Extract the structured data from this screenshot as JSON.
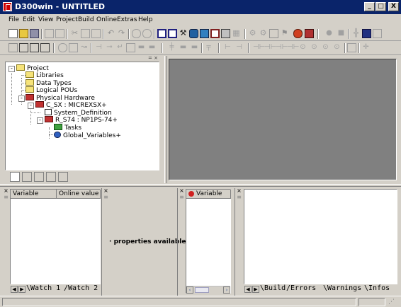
{
  "window": {
    "title": "D300win - UNTITLED",
    "minimize": "_",
    "maximize": "□",
    "close": "X"
  },
  "menu": [
    "File",
    "Edit",
    "View",
    "Project",
    "Build",
    "Online",
    "Extras",
    "Help"
  ],
  "project_tree": {
    "root": "Project",
    "items": [
      "Libraries",
      "Data Types",
      "Logical POUs",
      "Physical Hardware",
      "C_SX : MICREXSX+",
      "System_Definition",
      "R_S74 : NP1PS-74+",
      "Tasks",
      "Global_Variables+"
    ]
  },
  "watch_panel": {
    "col_variable": "Variable",
    "col_online_value": "Online value",
    "tabs": [
      "Watch 1",
      "Watch 2"
    ]
  },
  "properties_panel": {
    "message": "properties available"
  },
  "variable_panel": {
    "col_variable": "Variable"
  },
  "build_panel": {
    "tabs": [
      "Build",
      "Errors",
      "Warnings",
      "Infos"
    ]
  }
}
